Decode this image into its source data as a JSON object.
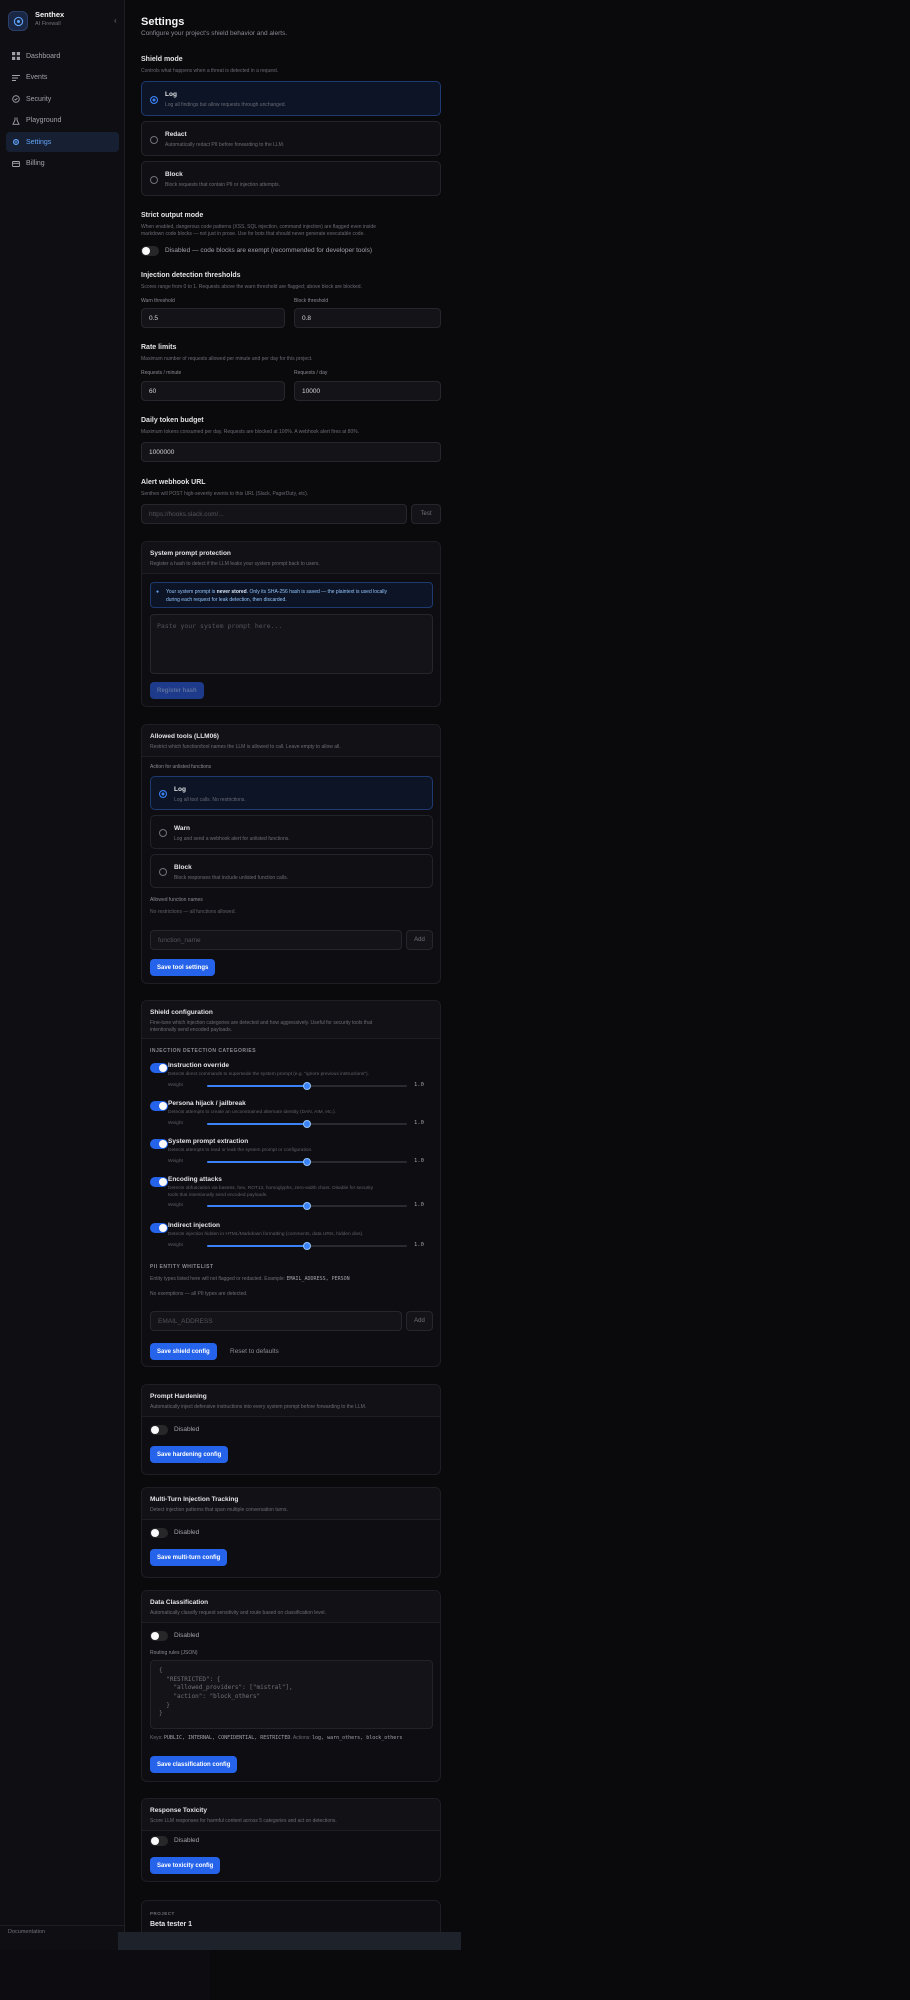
{
  "brand": {
    "name": "Senthex",
    "sub": "AI Firewall",
    "collapse_glyph": "‹"
  },
  "nav": [
    {
      "label": "Dashboard",
      "icon": "grid-icon",
      "active": false
    },
    {
      "label": "Events",
      "icon": "list-icon",
      "active": false
    },
    {
      "label": "Security",
      "icon": "shield-icon",
      "active": false
    },
    {
      "label": "Playground",
      "icon": "flask-icon",
      "active": false
    },
    {
      "label": "Settings",
      "icon": "gear-icon",
      "active": true
    },
    {
      "label": "Billing",
      "icon": "card-icon",
      "active": false
    }
  ],
  "sidebar_bottom": "Documentation",
  "page": {
    "title": "Settings",
    "subtitle": "Configure your project's shield behavior and alerts."
  },
  "shield_mode": {
    "title": "Shield mode",
    "desc": "Controls what happens when a threat is detected in a request.",
    "options": [
      {
        "title": "Log",
        "desc": "Log all findings but allow requests through unchanged.",
        "selected": true
      },
      {
        "title": "Redact",
        "desc": "Automatically redact PII before forwarding to the LLM.",
        "selected": false
      },
      {
        "title": "Block",
        "desc": "Block requests that contain PII or injection attempts.",
        "selected": false
      }
    ]
  },
  "strict_output": {
    "title": "Strict output mode",
    "desc1": "When enabled, dangerous code patterns (XSS, SQL injection, command injection) are flagged even inside",
    "desc2": "markdown code blocks — not just in prose. Use for bots that should never generate executable code.",
    "toggle_label": "Disabled — code blocks are exempt (recommended for developer tools)",
    "enabled": false
  },
  "thresholds": {
    "title": "Injection detection thresholds",
    "desc": "Scores range from 0 to 1. Requests above the warn threshold are flagged; above block are blocked.",
    "warn_label": "Warn threshold",
    "warn_value": "0.5",
    "block_label": "Block threshold",
    "block_value": "0.8"
  },
  "rate_limits": {
    "title": "Rate limits",
    "desc": "Maximum number of requests allowed per minute and per day for this project.",
    "minute_label": "Requests / minute",
    "minute_value": "60",
    "day_label": "Requests / day",
    "day_value": "10000"
  },
  "token_budget": {
    "title": "Daily token budget",
    "desc": "Maximum tokens consumed per day. Requests are blocked at 100%. A webhook alert fires at 80%.",
    "value": "1000000"
  },
  "webhook": {
    "title": "Alert webhook URL",
    "desc": "Senthex will POST high-severity events to this URL (Slack, PagerDuty, etc).",
    "placeholder": "https://hooks.slack.com/...",
    "test_label": "Test"
  },
  "system_prompt": {
    "title": "System prompt protection",
    "desc": "Register a hash to detect if the LLM leaks your system prompt back to users.",
    "notice_a": "Your system prompt is ",
    "notice_b": "never stored",
    "notice_c": ". Only its SHA-256 hash is saved — the plaintext is used locally",
    "notice_d": "during each request for leak detection, then discarded.",
    "placeholder": "Paste your system prompt here...",
    "button": "Register hash"
  },
  "allowed_tools": {
    "title": "Allowed tools (LLM06)",
    "desc": "Restrict which function/tool names the LLM is allowed to call. Leave empty to allow all.",
    "action_label": "Action for unlisted functions",
    "options": [
      {
        "title": "Log",
        "desc": "Log all tool calls. No restrictions.",
        "selected": true
      },
      {
        "title": "Warn",
        "desc": "Log and send a webhook alert for unlisted functions.",
        "selected": false
      },
      {
        "title": "Block",
        "desc": "Block responses that include unlisted function calls.",
        "selected": false
      }
    ],
    "names_label": "Allowed function names",
    "names_empty": "No restrictions — all functions allowed.",
    "placeholder": "function_name",
    "add_label": "Add",
    "save": "Save tool settings"
  },
  "shield_config": {
    "title": "Shield configuration",
    "desc1": "Fine-tune which injection categories are detected and how aggressively. Useful for security tools that",
    "desc2": "intentionally send encoded payloads.",
    "categories_heading": "INJECTION DETECTION CATEGORIES",
    "weight_label": "Weight",
    "categories": [
      {
        "title": "Instruction override",
        "desc": "Detects direct commands to supersede the system prompt (e.g. \"ignore previous instructions\").",
        "enabled": true,
        "weight": 1.0,
        "weight_text": "1.0"
      },
      {
        "title": "Persona hijack / jailbreak",
        "desc": "Detects attempts to create an unconstrained alternate identity (DAN, AIM, etc.).",
        "enabled": true,
        "weight": 1.0,
        "weight_text": "1.0"
      },
      {
        "title": "System prompt extraction",
        "desc": "Detects attempts to read or leak the system prompt or configuration.",
        "enabled": true,
        "weight": 1.0,
        "weight_text": "1.0"
      },
      {
        "title": "Encoding attacks",
        "desc": "Detects obfuscation via base64, hex, ROT13, homoglyphs, zero-width chars. Disable for security",
        "desc2": "tools that intentionally send encoded payloads.",
        "enabled": true,
        "weight": 1.0,
        "weight_text": "1.0"
      },
      {
        "title": "Indirect injection",
        "desc": "Detects injection hidden in HTML/Markdown formatting (comments, data URIs, hidden divs).",
        "enabled": true,
        "weight": 1.0,
        "weight_text": "1.0"
      }
    ],
    "pii_heading": "PII ENTITY WHITELIST",
    "pii_desc_a": "Entity types listed here will not flagged or redacted. Example: ",
    "pii_desc_b": "EMAIL_ADDRESS, PERSON",
    "pii_empty": "No exemptions — all PII types are detected.",
    "pii_placeholder": "EMAIL_ADDRESS",
    "add_label": "Add",
    "save": "Save shield config",
    "reset": "Reset to defaults"
  },
  "prompt_hardening": {
    "title": "Prompt Hardening",
    "desc": "Automatically inject defensive instructions into every system prompt before forwarding to the LLM.",
    "toggle_label": "Disabled",
    "save": "Save hardening config"
  },
  "multi_turn": {
    "title": "Multi-Turn Injection Tracking",
    "desc": "Detect injection patterns that span multiple conversation turns.",
    "toggle_label": "Disabled",
    "save": "Save multi-turn config"
  },
  "data_class": {
    "title": "Data Classification",
    "desc": "Automatically classify request sensitivity and route based on classification level.",
    "toggle_label": "Disabled",
    "rules_label": "Routing rules (JSON)",
    "code": "{\n  \"RESTRICTED\": {\n    \"allowed_providers\": [\"mistral\"],\n    \"action\": \"block_others\"\n  }\n}",
    "levels_a": "Keys: ",
    "levels_b": "PUBLIC, INTERNAL, CONFIDENTIAL, RESTRICTED",
    "levels_c": ". Actions: ",
    "levels_d": "log, warn_others, block_others",
    "save": "Save classification config"
  },
  "toxicity": {
    "title": "Response Toxicity",
    "desc": "Score LLM responses for harmful content across 5 categories and act on detections.",
    "toggle_label": "Disabled",
    "save": "Save toxicity config"
  },
  "project": {
    "label": "PROJECT",
    "name": "Beta tester 1"
  }
}
